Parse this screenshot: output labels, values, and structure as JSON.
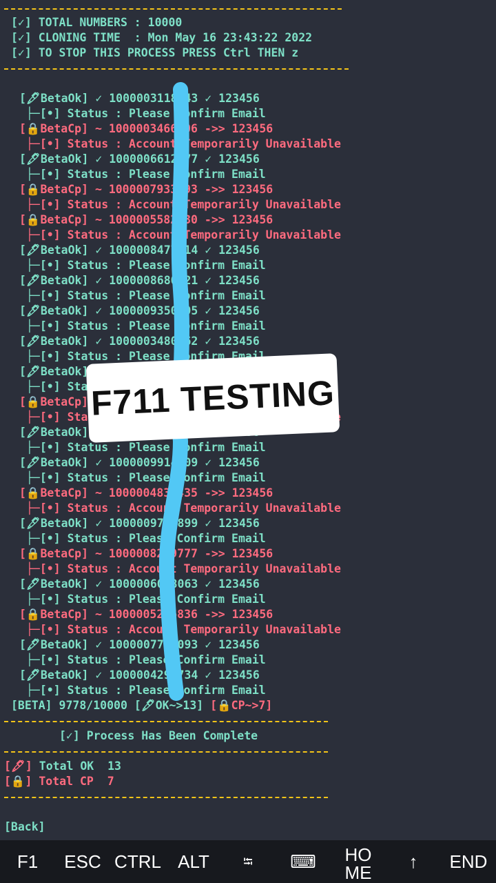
{
  "header": {
    "total": "[✓] TOTAL NUMBERS : 10000",
    "time": "[✓] CLONING TIME  : Mon May 16 23:43:22 2022",
    "stop": "[✓] TO STOP THIS PROCESS PRESS Ctrl THEN z"
  },
  "results": [
    {
      "type": "ok",
      "line": "[🖋BetaOk] ✓ 1000003118043 ✓ 123456",
      "status": "├─[•] Status : Please Confirm Email"
    },
    {
      "type": "cp",
      "line": "[🔒BetaCp] ~ 1000003466406 ->> 123456",
      "status": "├─[•] Status : Account Temporarily Unavailable"
    },
    {
      "type": "ok",
      "line": "[🖋BetaOk] ✓ 1000006612177 ✓ 123456",
      "status": "├─[•] Status : Please Confirm Email"
    },
    {
      "type": "cp",
      "line": "[🔒BetaCp] ~ 1000007933193 ->> 123456",
      "status": "├─[•] Status : Account Temporarily Unavailable"
    },
    {
      "type": "cp",
      "line": "[🔒BetaCp] ~ 1000005582330 ->> 123456",
      "status": "├─[•] Status : Account Temporarily Unavailable"
    },
    {
      "type": "ok",
      "line": "[🖋BetaOk] ✓ 1000008477014 ✓ 123456",
      "status": "├─[•] Status : Please Confirm Email"
    },
    {
      "type": "ok",
      "line": "[🖋BetaOk] ✓ 1000008680421 ✓ 123456",
      "status": "├─[•] Status : Please Confirm Email"
    },
    {
      "type": "ok",
      "line": "[🖋BetaOk] ✓ 1000009350895 ✓ 123456",
      "status": "├─[•] Status : Please Confirm Email"
    },
    {
      "type": "ok",
      "line": "[🖋BetaOk] ✓ 1000003480762 ✓ 123456",
      "status": "├─[•] Status : Please Confirm Email"
    },
    {
      "type": "ok",
      "line": "[🖋BetaOk] ✓ 1000009945123 ✓ 123456",
      "status": "├─[•] Status : Please Confirm Email"
    },
    {
      "type": "cp",
      "line": "[🔒BetaCp] ~ 1000006734021 ->> 123456",
      "status": "├─[•] Status : Account Temporarily Unavailable"
    },
    {
      "type": "ok",
      "line": "[🖋BetaOk] ✓ 1000002251033 ✓ 123456",
      "status": "├─[•] Status : Please Confirm Email"
    },
    {
      "type": "ok",
      "line": "[🖋BetaOk] ✓ 1000009914909 ✓ 123456",
      "status": "├─[•] Status : Please Confirm Email"
    },
    {
      "type": "cp",
      "line": "[🔒BetaCp] ~ 1000004835435 ->> 123456",
      "status": "├─[•] Status : Account Temporarily Unavailable"
    },
    {
      "type": "ok",
      "line": "[🖋BetaOk] ✓ 1000009751899 ✓ 123456",
      "status": "├─[•] Status : Please Confirm Email"
    },
    {
      "type": "cp",
      "line": "[🔒BetaCp] ~ 1000008259777 ->> 123456",
      "status": "├─[•] Status : Account Temporarily Unavailable"
    },
    {
      "type": "ok",
      "line": "[🖋BetaOk] ✓ 1000006048063 ✓ 123456",
      "status": "├─[•] Status : Please Confirm Email"
    },
    {
      "type": "cp",
      "line": "[🔒BetaCp] ~ 1000005266836 ->> 123456",
      "status": "├─[•] Status : Account Temporarily Unavailable"
    },
    {
      "type": "ok",
      "line": "[🖋BetaOk] ✓ 1000007748093 ✓ 123456",
      "status": "├─[•] Status : Please Confirm Email"
    },
    {
      "type": "ok",
      "line": "[🖋BetaOk] ✓ 1000004292734 ✓ 123456",
      "status": "├─[•] Status : Please Confirm Email"
    }
  ],
  "beta": {
    "prefix": "[BETA] 9778/10000 ",
    "ok": "[🖋OK~>13]",
    "cp": "[🔒CP~>7]"
  },
  "complete": "[✓] Process Has Been Complete",
  "totals": {
    "ok_icon": "[🖋]",
    "ok_label": " Total OK  13",
    "cp_icon": "[🔒]",
    "cp_label": " Total CP  7"
  },
  "back": "[Back]",
  "sticker": "F711 TESTING",
  "keys": [
    "F1",
    "ESC",
    "CTRL",
    "ALT",
    "⭾",
    "⌨",
    "HOME",
    "↑",
    "END"
  ],
  "colors": {
    "ok": "#7ee0c7",
    "cp": "#ff6b7f",
    "separator": "#f5c518",
    "stroke": "#52c8f5"
  }
}
